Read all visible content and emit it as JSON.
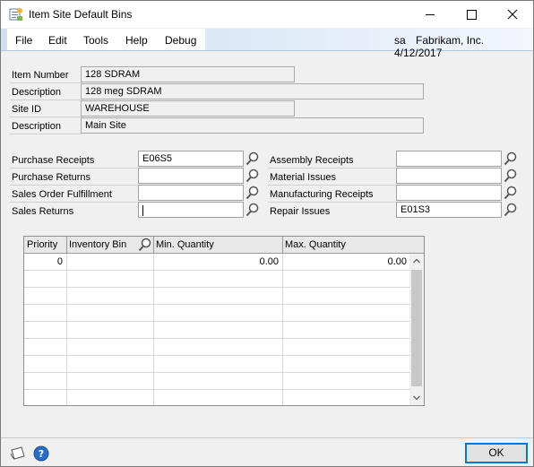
{
  "window": {
    "title": "Item Site Default Bins",
    "controls": {
      "minimize": "—",
      "maximize": "☐",
      "close": "✕"
    }
  },
  "menu": {
    "items": [
      "File",
      "Edit",
      "Tools",
      "Help",
      "Debug"
    ],
    "status": {
      "user": "sa",
      "company": "Fabrikam, Inc.",
      "date": "4/12/2017"
    }
  },
  "header": {
    "item_number_label": "Item Number",
    "item_number": "128 SDRAM",
    "item_description_label": "Description",
    "item_description": "128 meg SDRAM",
    "site_id_label": "Site ID",
    "site_id": "WAREHOUSE",
    "site_description_label": "Description",
    "site_description": "Main Site"
  },
  "bins_left": [
    {
      "label": "Purchase Receipts",
      "value": "E06S5"
    },
    {
      "label": "Purchase Returns",
      "value": ""
    },
    {
      "label": "Sales Order Fulfillment",
      "value": ""
    },
    {
      "label": "Sales Returns",
      "value": ""
    }
  ],
  "bins_right": [
    {
      "label": "Assembly Receipts",
      "value": ""
    },
    {
      "label": "Material Issues",
      "value": ""
    },
    {
      "label": "Manufacturing Receipts",
      "value": ""
    },
    {
      "label": "Repair Issues",
      "value": "E01S3"
    }
  ],
  "grid": {
    "columns": [
      "Priority",
      "Inventory Bin",
      "Min. Quantity",
      "Max. Quantity"
    ],
    "rows": [
      {
        "priority": "0",
        "bin": "",
        "min": "0.00",
        "max": "0.00"
      }
    ]
  },
  "footer": {
    "ok_label": "OK"
  },
  "icons": {
    "lookup": "magnifier-icon",
    "note": "note-icon",
    "help": "help-icon",
    "app": "app-icon"
  },
  "colors": {
    "menubar": "#cfe0f3",
    "accent": "#0078d7",
    "help_icon": "#2a6cc4"
  }
}
